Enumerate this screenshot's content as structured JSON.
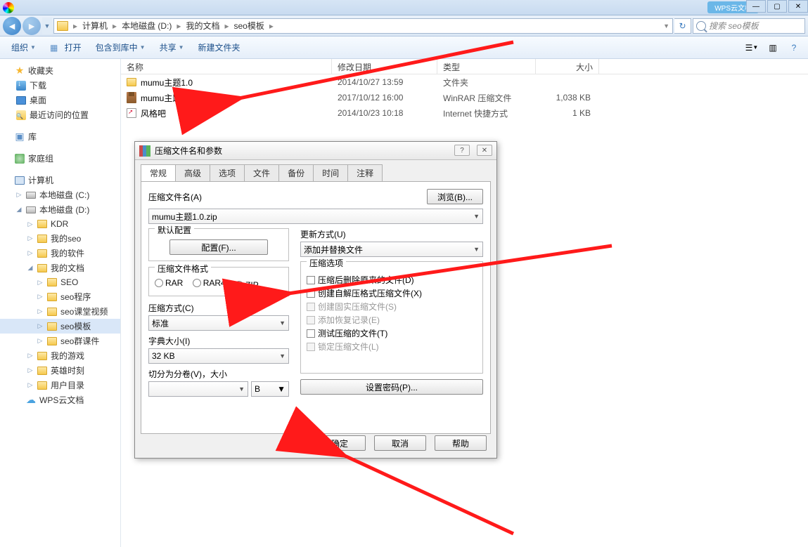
{
  "titlebar_app": "WPS云文档",
  "breadcrumb": [
    "计算机",
    "本地磁盘 (D:)",
    "我的文档",
    "seo模板"
  ],
  "search_placeholder": "搜索 seo模板",
  "toolbar": {
    "organize": "组织",
    "open": "打开",
    "include": "包含到库中",
    "share": "共享",
    "newfolder": "新建文件夹"
  },
  "columns": {
    "name": "名称",
    "date": "修改日期",
    "type": "类型",
    "size": "大小"
  },
  "files": [
    {
      "icon": "folder",
      "name": "mumu主题1.0",
      "date": "2014/10/27 13:59",
      "type": "文件夹",
      "size": ""
    },
    {
      "icon": "rar",
      "name": "mumu主题1.0.rar",
      "date": "2017/10/12 16:00",
      "type": "WinRAR 压缩文件",
      "size": "1,038 KB"
    },
    {
      "icon": "link",
      "name": "风格吧",
      "date": "2014/10/23 10:18",
      "type": "Internet 快捷方式",
      "size": "1 KB"
    }
  ],
  "sidebar": {
    "fav": "收藏夹",
    "downloads": "下载",
    "desktop": "桌面",
    "recent": "最近访问的位置",
    "lib": "库",
    "homegroup": "家庭组",
    "computer": "计算机",
    "driveC": "本地磁盘 (C:)",
    "driveD": "本地磁盘 (D:)",
    "kdr": "KDR",
    "myseo": "我的seo",
    "mysoft": "我的软件",
    "mydocs": "我的文档",
    "seo": "SEO",
    "seoprog": "seo程序",
    "seoclass": "seo课堂视频",
    "seotpl": "seo模板",
    "seogroup": "seo群课件",
    "mygames": "我的游戏",
    "hero": "英雄时刻",
    "userdir": "用户目录",
    "wps": "WPS云文档"
  },
  "dialog": {
    "title": "压缩文件名和参数",
    "tabs": [
      "常规",
      "高级",
      "选项",
      "文件",
      "备份",
      "时间",
      "注释"
    ],
    "archive_label": "压缩文件名(A)",
    "archive_value": "mumu主题1.0.zip",
    "browse": "浏览(B)...",
    "profile_label": "默认配置",
    "profile_btn": "配置(F)...",
    "update_label": "更新方式(U)",
    "update_value": "添加并替换文件",
    "format_label": "压缩文件格式",
    "fmt_rar": "RAR",
    "fmt_rar4": "RAR4",
    "fmt_zip": "ZIP",
    "method_label": "压缩方式(C)",
    "method_value": "标准",
    "dict_label": "字典大小(I)",
    "dict_value": "32 KB",
    "split_label": "切分为分卷(V)，大小",
    "split_unit": "B",
    "opts_label": "压缩选项",
    "opt_del": "压缩后删除原来的文件(D)",
    "opt_sfx": "创建自解压格式压缩文件(X)",
    "opt_solid": "创建固实压缩文件(S)",
    "opt_rr": "添加恢复记录(E)",
    "opt_test": "测试压缩的文件(T)",
    "opt_lock": "锁定压缩文件(L)",
    "password": "设置密码(P)...",
    "ok": "确定",
    "cancel": "取消",
    "help": "帮助"
  }
}
